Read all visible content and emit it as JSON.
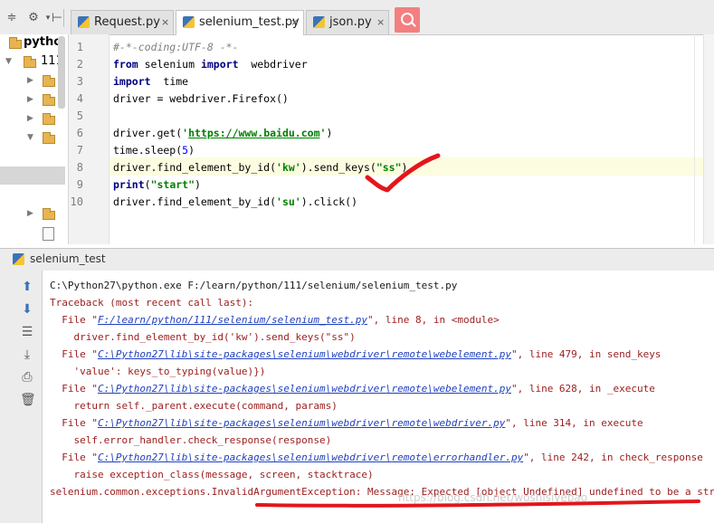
{
  "tabs": [
    {
      "label": "Request.py",
      "active": false
    },
    {
      "label": "selenium_test.py",
      "active": true
    },
    {
      "label": "json.py",
      "active": false
    }
  ],
  "tab_close_glyph": "×",
  "project_tree": {
    "root_label": "pytho",
    "child_label": "111"
  },
  "editor": {
    "line_numbers": [
      "1",
      "2",
      "3",
      "4",
      "5",
      "6",
      "7",
      "8",
      "9",
      "10"
    ],
    "current_line": 8
  },
  "run_panel": {
    "title": "selenium_test"
  },
  "console": {
    "lines": [
      "C:\\Python27\\python.exe F:/learn/python/111/selenium/selenium_test.py",
      "Traceback (most recent call last):",
      "  File \"",
      "    driver.find_element_by_id('kw').send_keys(\"ss\")",
      "  File \"",
      "    'value': keys_to_typing(value)})",
      "  File \"",
      "    return self._parent.execute(command, params)",
      "  File \"",
      "    self.error_handler.check_response(response)",
      "  File \"",
      "    raise exception_class(message, screen, stacktrace)",
      "selenium.common.exceptions.InvalidArgumentException: Message: Expected [object Undefined] undefined to be a string"
    ],
    "frames": [
      {
        "path": "F:/learn/python/111/selenium/selenium_test.py",
        "rest": "\", line 8, in <module>"
      },
      {
        "path": "C:\\Python27\\lib\\site-packages\\selenium\\webdriver\\remote\\webelement.py",
        "rest": "\", line 479, in send_keys"
      },
      {
        "path": "C:\\Python27\\lib\\site-packages\\selenium\\webdriver\\remote\\webelement.py",
        "rest": "\", line 628, in _execute"
      },
      {
        "path": "C:\\Python27\\lib\\site-packages\\selenium\\webdriver\\remote\\webdriver.py",
        "rest": "\", line 314, in execute"
      },
      {
        "path": "C:\\Python27\\lib\\site-packages\\selenium\\webdriver\\remote\\errorhandler.py",
        "rest": "\", line 242, in check_response"
      }
    ]
  },
  "watermark": "https://blog.csdn.net/woshisiyebao",
  "colors": {
    "keyword": "#000080",
    "string": "#008000",
    "error_text": "#9b1c1c",
    "link": "#1f3fbf",
    "annotation_red": "#e3161b",
    "search_button": "#f37f7f"
  }
}
